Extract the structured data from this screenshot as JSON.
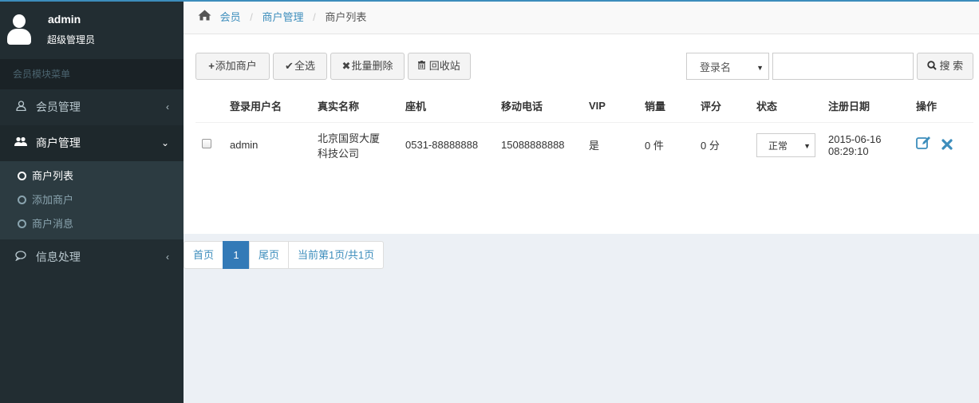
{
  "user": {
    "name": "admin",
    "role": "超级管理员"
  },
  "sidebar": {
    "header": "会员模块菜单",
    "items": [
      {
        "label": "会员管理",
        "icon": "user-icon",
        "chevron": "‹"
      },
      {
        "label": "商户管理",
        "icon": "users-icon",
        "chevron": "⌄"
      },
      {
        "label": "信息处理",
        "icon": "comment-icon",
        "chevron": "‹"
      }
    ],
    "submenu": [
      {
        "label": "商户列表"
      },
      {
        "label": "添加商户"
      },
      {
        "label": "商户消息"
      }
    ]
  },
  "breadcrumb": {
    "home": "会员",
    "section": "商户管理",
    "current": "商户列表"
  },
  "toolbar": {
    "add": "添加商户",
    "select_all": "全选",
    "batch_delete": "批量删除",
    "recycle": "回收站",
    "search_field": "登录名",
    "search_value": "",
    "search_button": "搜 索"
  },
  "table": {
    "columns": [
      "登录用户名",
      "真实名称",
      "座机",
      "移动电话",
      "VIP",
      "销量",
      "评分",
      "状态",
      "注册日期",
      "操作"
    ],
    "rows": [
      {
        "username": "admin",
        "realname_line1": "北京国贸大厦",
        "realname_line2": "科技公司",
        "phone": "0531-88888888",
        "mobile": "15088888888",
        "vip": "是",
        "sales": "0 件",
        "rating": "0 分",
        "status": "正常",
        "date_line1": "2015-06-16",
        "date_line2": "08:29:10"
      }
    ]
  },
  "pagination": {
    "first": "首页",
    "page": "1",
    "last": "尾页",
    "info": "当前第1页/共1页"
  },
  "colors": {
    "accent": "#3c8dbc",
    "sidebar": "#222d32",
    "active_page": "#337ab7"
  }
}
